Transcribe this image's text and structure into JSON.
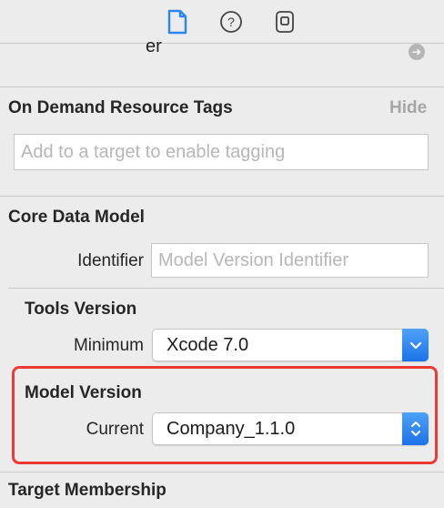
{
  "toolbar": {
    "icons": [
      "file-inspector-icon",
      "quick-help-icon",
      "identity-inspector-icon"
    ],
    "active_color": "#2b86f2"
  },
  "top_partial": {
    "text": "er"
  },
  "on_demand": {
    "title": "On Demand Resource Tags",
    "hide_label": "Hide",
    "placeholder": "Add to a target to enable tagging"
  },
  "core_data": {
    "title": "Core Data Model",
    "identifier_label": "Identifier",
    "identifier_placeholder": "Model Version Identifier"
  },
  "tools_version": {
    "title": "Tools Version",
    "minimum_label": "Minimum",
    "minimum_value": "Xcode 7.0"
  },
  "model_version": {
    "title": "Model Version",
    "current_label": "Current",
    "current_value": "Company_1.1.0"
  },
  "target_membership": {
    "title": "Target Membership"
  },
  "colors": {
    "accent": "#2b86f2",
    "highlight": "#ee3a33"
  }
}
